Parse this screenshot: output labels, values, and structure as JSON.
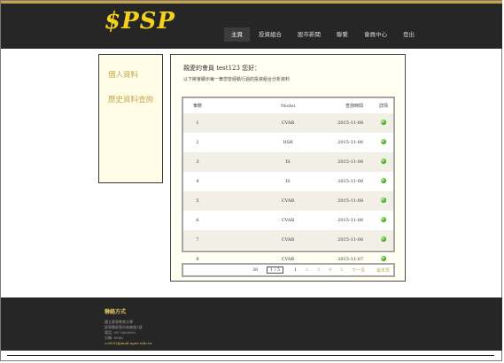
{
  "logo": "$PSP",
  "nav": [
    "主頁",
    "投資組合",
    "股市新聞",
    "聯繫",
    "會員中心",
    "登出"
  ],
  "sidebar": {
    "items": [
      "個人資料",
      "歷史資料查詢"
    ]
  },
  "panel": {
    "greeting": "親愛的會員 test123 您好：",
    "note": "以下將會顯示每一筆您曾經執行過的投資組合分析資料"
  },
  "table": {
    "headers": [
      "筆數",
      "Model",
      "查詢時間",
      "詳情"
    ],
    "rows": [
      [
        "1",
        "CVAR",
        "2015-11-08"
      ],
      [
        "2",
        "DSR",
        "2015-11-08"
      ],
      [
        "3",
        "IS",
        "2015-11-08"
      ],
      [
        "4",
        "IS",
        "2015-11-08"
      ],
      [
        "5",
        "CVAR",
        "2015-11-08"
      ],
      [
        "6",
        "CVAR",
        "2015-11-08"
      ],
      [
        "7",
        "CVAR",
        "2015-11-08"
      ],
      [
        "8",
        "CVAR",
        "2015-11-07"
      ]
    ]
  },
  "pager": {
    "total": "36",
    "current": "1 / 5",
    "pages": [
      "1",
      "2",
      "3",
      "4",
      "5"
    ],
    "next": "下一頁",
    "last": "最末頁"
  },
  "footer": {
    "title": "聯絡方式",
    "lines": [
      "國立屏東教育大學",
      "屏東縣屏東市林森路1號",
      "電話: 08-7663800",
      "分機: 8848"
    ],
    "email": "cc6002@mail.npue.edu.tw"
  }
}
